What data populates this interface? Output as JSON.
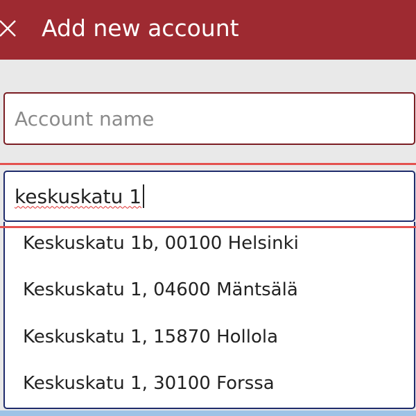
{
  "header": {
    "title": "Add new account",
    "close_icon": "close-icon",
    "background": "#9e2a31"
  },
  "account_name": {
    "value": "",
    "placeholder": "Account name"
  },
  "address_input": {
    "value": "keskuskatu 1"
  },
  "suggestions": [
    "Keskuskatu 1b, 00100 Helsinki",
    "Keskuskatu 1, 04600 Mäntsälä",
    "Keskuskatu 1, 15870 Hollola",
    "Keskuskatu 1, 30100 Forssa"
  ],
  "colors": {
    "accent_red": "#e4514e",
    "focus_border": "#1d2a6b"
  }
}
